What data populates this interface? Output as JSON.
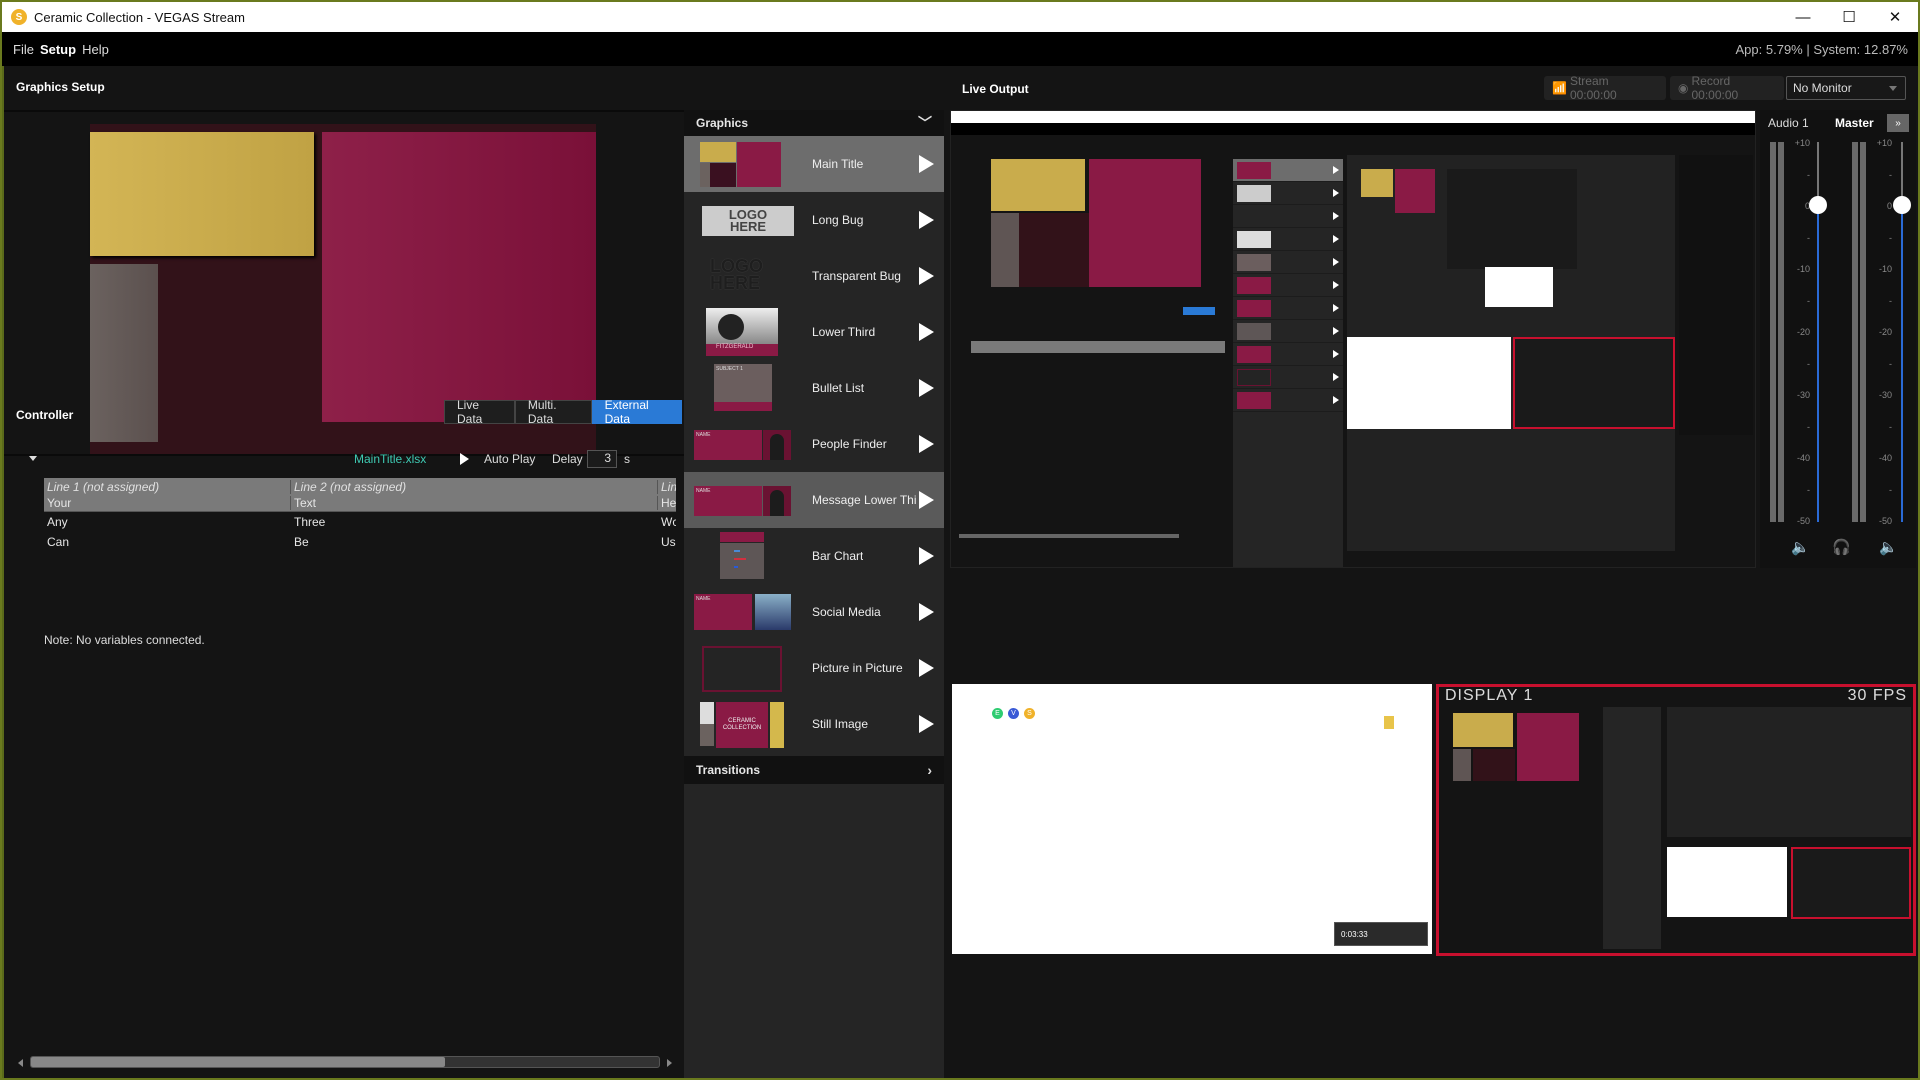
{
  "window": {
    "title": "Ceramic Collection - VEGAS Stream",
    "app_icon_letter": "S",
    "minimize": "—",
    "maximize": "☐",
    "close": "✕"
  },
  "menu": {
    "items": [
      "File",
      "Setup",
      "Help"
    ],
    "stats": "App: 5.79% | System: 12.87%"
  },
  "graphics_setup": {
    "title": "Graphics Setup",
    "preview_colors": {
      "yellow": "#c9ac4c",
      "red": "#8a1a45",
      "grey": "#5f5554",
      "dark": "#321219"
    }
  },
  "controller": {
    "title": "Controller",
    "tabs": [
      {
        "label": "Live Data",
        "active": false
      },
      {
        "label": "Multi. Data",
        "active": false
      },
      {
        "label": "External Data",
        "active": true
      }
    ],
    "file_name": "MainTitle.xlsx",
    "auto_play_label": "Auto Play",
    "delay_label": "Delay",
    "delay_value": "3",
    "delay_unit": "s",
    "table": {
      "headers": [
        "Line 1 (not assigned)",
        "Line 2 (not assigned)",
        "Lin"
      ],
      "rows": [
        [
          "Your",
          "Text",
          "He"
        ],
        [
          "Any",
          "Three",
          "Wc"
        ],
        [
          "Can",
          "Be",
          "Use"
        ]
      ]
    },
    "note": "Note: No variables connected.",
    "scroll_fraction": 0.66
  },
  "graphics": {
    "title": "Graphics",
    "items": [
      {
        "label": "Main Title",
        "selected": true
      },
      {
        "label": "Long Bug"
      },
      {
        "label": "Transparent Bug"
      },
      {
        "label": "Lower Third"
      },
      {
        "label": "Bullet List"
      },
      {
        "label": "People Finder"
      },
      {
        "label": "Message Lower Third",
        "hovered": true
      },
      {
        "label": "Bar Chart"
      },
      {
        "label": "Social Media"
      },
      {
        "label": "Picture in Picture"
      },
      {
        "label": "Still Image"
      }
    ],
    "thumb_texts": {
      "logo_line1": "LOGO",
      "logo_line2": "HERE",
      "lower_third_name": "FITZGERALD",
      "bullet_subject": "SUBJECT 1",
      "name": "NAME",
      "ceramic": "CERAMIC",
      "collection": "COLLECTION"
    },
    "transitions_label": "Transitions"
  },
  "live_output": {
    "title": "Live Output",
    "stream_label": "Stream 00:00:00",
    "record_label": "Record 00:00:00",
    "monitor_value": "No Monitor",
    "display_label": "DISPLAY 1",
    "fps_label": "30 FPS",
    "recorder_time": "0:03:33"
  },
  "audio": {
    "channel1_label": "Audio 1",
    "master_label": "Master",
    "expand_icon": "»",
    "scale": [
      "+10",
      "-",
      "0",
      "-",
      "-10",
      "-",
      "-20",
      "-",
      "-30",
      "-",
      "-40",
      "-",
      "-50"
    ],
    "channel1_db": 0,
    "master_db": 0
  }
}
